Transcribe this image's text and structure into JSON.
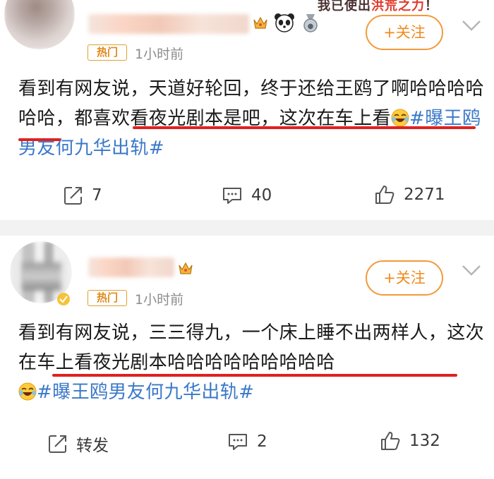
{
  "posts": [
    {
      "badge": "热门",
      "time": "1小时前",
      "follow_label": "+关注",
      "text_before": "看到有网友说，天道好轮回，终于还给王鸥了啊哈哈哈哈哈哈，",
      "text_underlined": "都喜欢看夜光剧本是吧，这次在车上看",
      "hashtag": "#曝王鸥男友何九华出轨#",
      "actions": {
        "repost": "7",
        "comment": "40",
        "like": "2271"
      }
    },
    {
      "badge": "热门",
      "time": "1小时前",
      "follow_label": "+关注",
      "text_before": "看到有网友说，三三得九，一个床上睡不出两样人，",
      "text_underlined": "这次在车上看夜光剧本哈哈哈哈哈哈哈哈哈",
      "hashtag": "#曝王鸥男友何九华出轨#",
      "actions": {
        "repost": "转发",
        "comment": "2",
        "like": "132"
      }
    }
  ],
  "banner_text": {
    "prefix": "我已使出",
    "highlight": "洪荒之力",
    "suffix": "！"
  },
  "icons": [
    "repost-icon",
    "comment-icon",
    "like-icon",
    "chevron-down-icon",
    "crown-icon",
    "panda-icon",
    "medal-icon",
    "laughing-emoji-icon"
  ],
  "colors": {
    "accent": "#f08a1e",
    "hashtag": "#3a78c8",
    "underline": "#e02020",
    "badge": "#e0a02c"
  }
}
